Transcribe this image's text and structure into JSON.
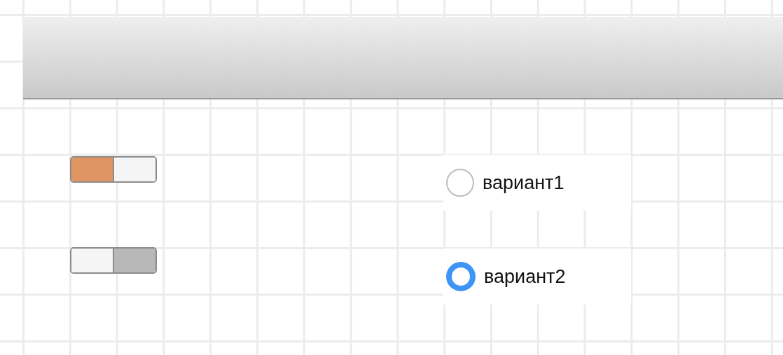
{
  "switches": [
    {
      "on": true
    },
    {
      "on": false
    }
  ],
  "radios": [
    {
      "label": "вариант1",
      "selected": false
    },
    {
      "label": "вариант2",
      "selected": true
    }
  ]
}
